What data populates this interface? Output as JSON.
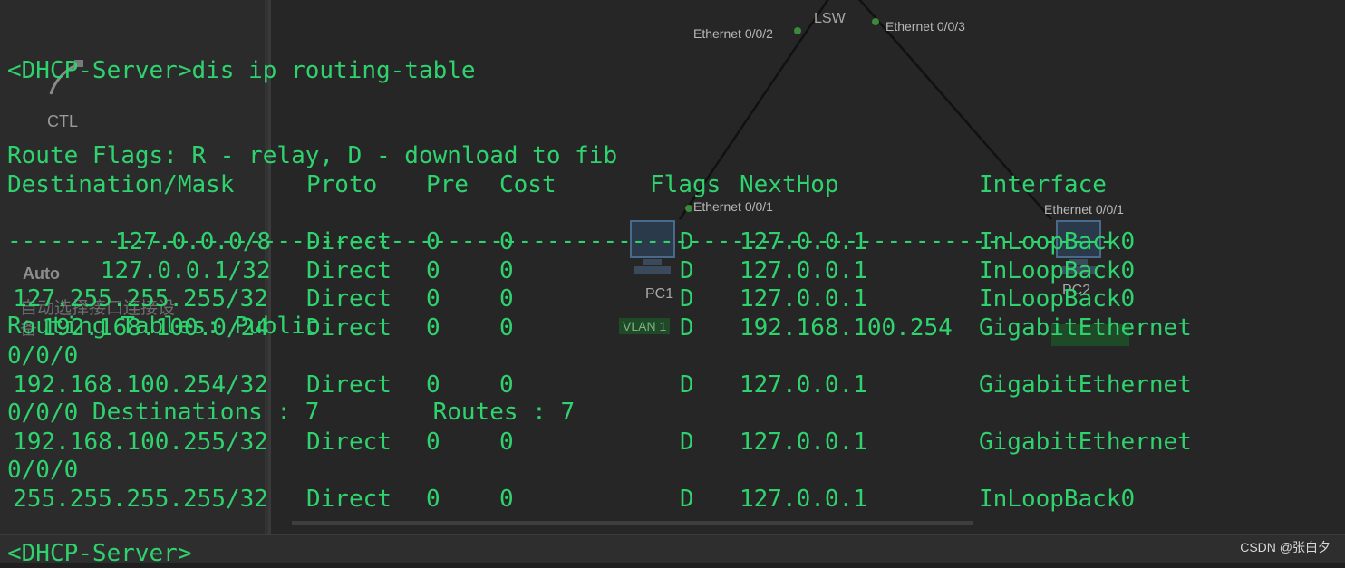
{
  "terminal": {
    "prompt_command": "<DHCP-Server>dis ip routing-table",
    "route_flags": "Route Flags: R - relay, D - download to fib",
    "separator": "------------------------------------------------------------------------------",
    "routing_tables": "Routing Tables: Public",
    "destinations": "      Destinations : 7        Routes : 7",
    "headers": {
      "dest": "Destination/Mask",
      "proto": "Proto",
      "pre": "Pre",
      "cost": "Cost",
      "flags": "Flags",
      "nexthop": "NextHop",
      "interface": "Interface"
    },
    "rows": [
      {
        "dest": "127.0.0.0/8",
        "proto": "Direct",
        "pre": "0",
        "cost": "0",
        "flags": "D",
        "nexthop": "127.0.0.1",
        "iface": "InLoopBack0",
        "wrap": ""
      },
      {
        "dest": "127.0.0.1/32",
        "proto": "Direct",
        "pre": "0",
        "cost": "0",
        "flags": "D",
        "nexthop": "127.0.0.1",
        "iface": "InLoopBack0",
        "wrap": ""
      },
      {
        "dest": "127.255.255.255/32",
        "proto": "Direct",
        "pre": "0",
        "cost": "0",
        "flags": "D",
        "nexthop": "127.0.0.1",
        "iface": "InLoopBack0",
        "wrap": ""
      },
      {
        "dest": "192.168.100.0/24",
        "proto": "Direct",
        "pre": "0",
        "cost": "0",
        "flags": "D",
        "nexthop": "192.168.100.254",
        "iface": "GigabitEthernet",
        "wrap": "0/0/0"
      },
      {
        "dest": "192.168.100.254/32",
        "proto": "Direct",
        "pre": "0",
        "cost": "0",
        "flags": "D",
        "nexthop": "127.0.0.1",
        "iface": "GigabitEthernet",
        "wrap": "0/0/0"
      },
      {
        "dest": "192.168.100.255/32",
        "proto": "Direct",
        "pre": "0",
        "cost": "0",
        "flags": "D",
        "nexthop": "127.0.0.1",
        "iface": "GigabitEthernet",
        "wrap": "0/0/0"
      },
      {
        "dest": "255.255.255.255/32",
        "proto": "Direct",
        "pre": "0",
        "cost": "0",
        "flags": "D",
        "nexthop": "127.0.0.1",
        "iface": "InLoopBack0",
        "wrap": ""
      }
    ],
    "final_prompt": "<DHCP-Server>"
  },
  "topology": {
    "switch_label": "LSW",
    "ports": {
      "lsw_e002": "Ethernet 0/0/2",
      "lsw_e003": "Ethernet 0/0/3",
      "pc1_port": "Ethernet 0/0/1",
      "pc2_port": "Ethernet 0/0/1"
    },
    "pc1_label": "PC1",
    "pc2_label": "PC2",
    "vlan_label": "VLAN 1"
  },
  "left_panel": {
    "ctl_label": "CTL",
    "auto_label": "Auto",
    "cn_text_1": "自动选择接口连接设",
    "cn_text_2": "备"
  },
  "watermark": "CSDN @张白夕",
  "colors": {
    "terminal_text": "#2fd36e",
    "background": "#1f1f1f"
  }
}
